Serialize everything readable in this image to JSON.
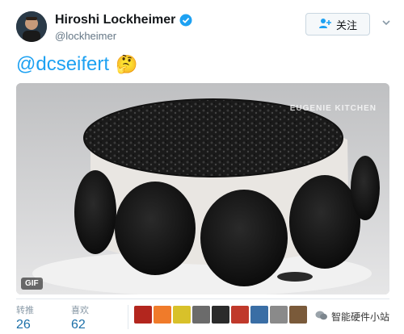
{
  "user": {
    "name": "Hiroshi Lockheimer",
    "handle": "@lockheimer"
  },
  "follow_button": {
    "label": "关注"
  },
  "tweet": {
    "text": "@dcseifert",
    "emoji": "🤔"
  },
  "media": {
    "badge": "GIF",
    "watermark": "EUGENIE KITCHEN"
  },
  "stats": [
    {
      "label": "转推",
      "value": "26"
    },
    {
      "label": "喜欢",
      "value": "62"
    }
  ],
  "likers": [
    {
      "color": "#b3261e"
    },
    {
      "color": "#f07b2a"
    },
    {
      "color": "#d8c12a"
    },
    {
      "color": "#6b6b6b"
    },
    {
      "color": "#2b2b2b"
    },
    {
      "color": "#c0392b"
    },
    {
      "color": "#3a6ea5"
    },
    {
      "color": "#8a8a8a"
    },
    {
      "color": "#7a5a3a"
    }
  ],
  "watermark": {
    "text": "智能硬件小站"
  },
  "colors": {
    "accent": "#1da1f2",
    "verified": "#1da1f2",
    "stat_value": "#1b6fa8"
  }
}
